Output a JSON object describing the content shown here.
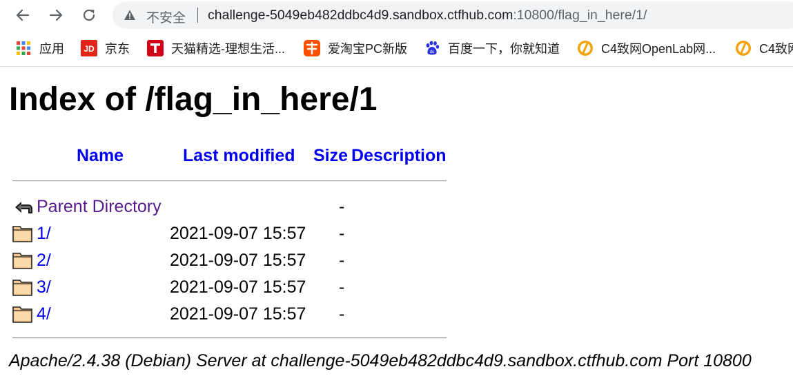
{
  "browser": {
    "security_label": "不安全",
    "url_host": "challenge-5049eb482ddbc4d9.sandbox.ctfhub.com",
    "url_rest": ":10800/flag_in_here/1/",
    "bookmarks": [
      {
        "label": "应用",
        "icon": "apps-grid-icon"
      },
      {
        "label": "京东",
        "icon": "jd-logo-icon"
      },
      {
        "label": "天猫精选-理想生活...",
        "icon": "tmall-logo-icon"
      },
      {
        "label": "爱淘宝PC新版",
        "icon": "taobao-logo-icon"
      },
      {
        "label": "百度一下，你就知道",
        "icon": "baidu-paw-icon"
      },
      {
        "label": "C4致网OpenLab网...",
        "icon": "c4-logo-icon"
      },
      {
        "label": "C4致网",
        "icon": "c4-logo-icon"
      }
    ]
  },
  "page": {
    "title": "Index of /flag_in_here/1",
    "columns": {
      "name": "Name",
      "last_modified": "Last modified",
      "size": "Size",
      "description": "Description"
    },
    "parent": {
      "name": "Parent Directory",
      "size": "-",
      "icon": "back-arrow-icon"
    },
    "entries": [
      {
        "name": "1/",
        "modified": "2021-09-07 15:57",
        "size": "-",
        "icon": "folder-icon"
      },
      {
        "name": "2/",
        "modified": "2021-09-07 15:57",
        "size": "-",
        "icon": "folder-icon"
      },
      {
        "name": "3/",
        "modified": "2021-09-07 15:57",
        "size": "-",
        "icon": "folder-icon"
      },
      {
        "name": "4/",
        "modified": "2021-09-07 15:57",
        "size": "-",
        "icon": "folder-icon"
      }
    ],
    "footer": "Apache/2.4.38 (Debian) Server at challenge-5049eb482ddbc4d9.sandbox.ctfhub.com Port 10800"
  },
  "colors": {
    "link": "#0000ee",
    "visited_link": "#551a8b",
    "omnibox_bg": "#f1f3f4"
  }
}
